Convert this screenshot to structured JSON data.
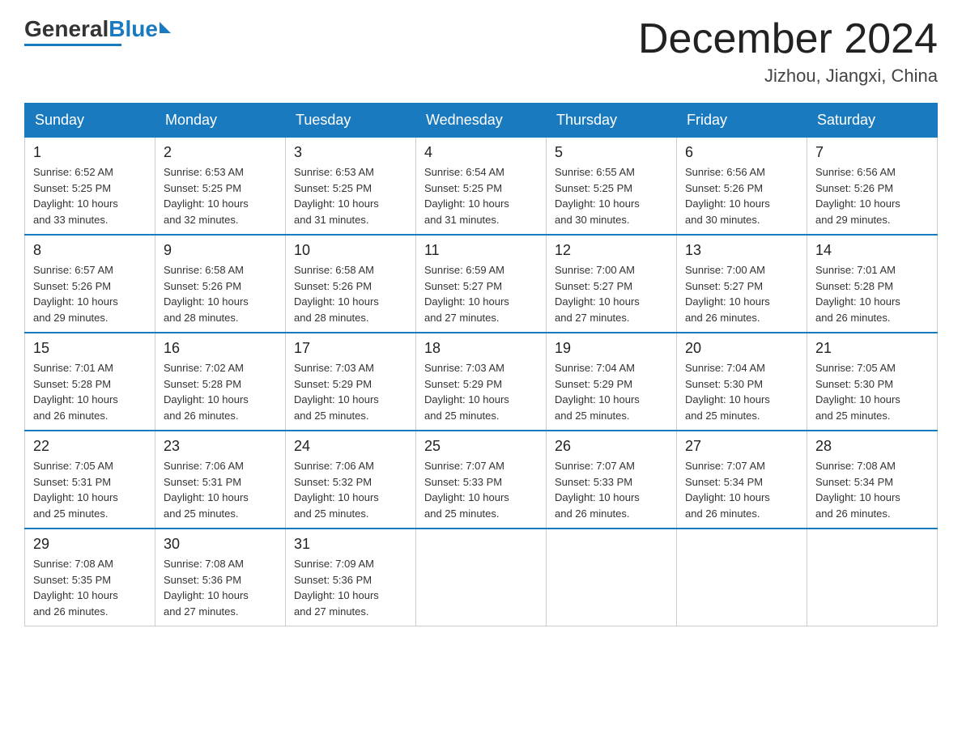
{
  "header": {
    "logo": {
      "general": "General",
      "blue": "Blue"
    },
    "title": "December 2024",
    "location": "Jizhou, Jiangxi, China"
  },
  "days_of_week": [
    "Sunday",
    "Monday",
    "Tuesday",
    "Wednesday",
    "Thursday",
    "Friday",
    "Saturday"
  ],
  "weeks": [
    [
      {
        "day": "1",
        "sunrise": "6:52 AM",
        "sunset": "5:25 PM",
        "daylight": "10 hours and 33 minutes."
      },
      {
        "day": "2",
        "sunrise": "6:53 AM",
        "sunset": "5:25 PM",
        "daylight": "10 hours and 32 minutes."
      },
      {
        "day": "3",
        "sunrise": "6:53 AM",
        "sunset": "5:25 PM",
        "daylight": "10 hours and 31 minutes."
      },
      {
        "day": "4",
        "sunrise": "6:54 AM",
        "sunset": "5:25 PM",
        "daylight": "10 hours and 31 minutes."
      },
      {
        "day": "5",
        "sunrise": "6:55 AM",
        "sunset": "5:25 PM",
        "daylight": "10 hours and 30 minutes."
      },
      {
        "day": "6",
        "sunrise": "6:56 AM",
        "sunset": "5:26 PM",
        "daylight": "10 hours and 30 minutes."
      },
      {
        "day": "7",
        "sunrise": "6:56 AM",
        "sunset": "5:26 PM",
        "daylight": "10 hours and 29 minutes."
      }
    ],
    [
      {
        "day": "8",
        "sunrise": "6:57 AM",
        "sunset": "5:26 PM",
        "daylight": "10 hours and 29 minutes."
      },
      {
        "day": "9",
        "sunrise": "6:58 AM",
        "sunset": "5:26 PM",
        "daylight": "10 hours and 28 minutes."
      },
      {
        "day": "10",
        "sunrise": "6:58 AM",
        "sunset": "5:26 PM",
        "daylight": "10 hours and 28 minutes."
      },
      {
        "day": "11",
        "sunrise": "6:59 AM",
        "sunset": "5:27 PM",
        "daylight": "10 hours and 27 minutes."
      },
      {
        "day": "12",
        "sunrise": "7:00 AM",
        "sunset": "5:27 PM",
        "daylight": "10 hours and 27 minutes."
      },
      {
        "day": "13",
        "sunrise": "7:00 AM",
        "sunset": "5:27 PM",
        "daylight": "10 hours and 26 minutes."
      },
      {
        "day": "14",
        "sunrise": "7:01 AM",
        "sunset": "5:28 PM",
        "daylight": "10 hours and 26 minutes."
      }
    ],
    [
      {
        "day": "15",
        "sunrise": "7:01 AM",
        "sunset": "5:28 PM",
        "daylight": "10 hours and 26 minutes."
      },
      {
        "day": "16",
        "sunrise": "7:02 AM",
        "sunset": "5:28 PM",
        "daylight": "10 hours and 26 minutes."
      },
      {
        "day": "17",
        "sunrise": "7:03 AM",
        "sunset": "5:29 PM",
        "daylight": "10 hours and 25 minutes."
      },
      {
        "day": "18",
        "sunrise": "7:03 AM",
        "sunset": "5:29 PM",
        "daylight": "10 hours and 25 minutes."
      },
      {
        "day": "19",
        "sunrise": "7:04 AM",
        "sunset": "5:29 PM",
        "daylight": "10 hours and 25 minutes."
      },
      {
        "day": "20",
        "sunrise": "7:04 AM",
        "sunset": "5:30 PM",
        "daylight": "10 hours and 25 minutes."
      },
      {
        "day": "21",
        "sunrise": "7:05 AM",
        "sunset": "5:30 PM",
        "daylight": "10 hours and 25 minutes."
      }
    ],
    [
      {
        "day": "22",
        "sunrise": "7:05 AM",
        "sunset": "5:31 PM",
        "daylight": "10 hours and 25 minutes."
      },
      {
        "day": "23",
        "sunrise": "7:06 AM",
        "sunset": "5:31 PM",
        "daylight": "10 hours and 25 minutes."
      },
      {
        "day": "24",
        "sunrise": "7:06 AM",
        "sunset": "5:32 PM",
        "daylight": "10 hours and 25 minutes."
      },
      {
        "day": "25",
        "sunrise": "7:07 AM",
        "sunset": "5:33 PM",
        "daylight": "10 hours and 25 minutes."
      },
      {
        "day": "26",
        "sunrise": "7:07 AM",
        "sunset": "5:33 PM",
        "daylight": "10 hours and 26 minutes."
      },
      {
        "day": "27",
        "sunrise": "7:07 AM",
        "sunset": "5:34 PM",
        "daylight": "10 hours and 26 minutes."
      },
      {
        "day": "28",
        "sunrise": "7:08 AM",
        "sunset": "5:34 PM",
        "daylight": "10 hours and 26 minutes."
      }
    ],
    [
      {
        "day": "29",
        "sunrise": "7:08 AM",
        "sunset": "5:35 PM",
        "daylight": "10 hours and 26 minutes."
      },
      {
        "day": "30",
        "sunrise": "7:08 AM",
        "sunset": "5:36 PM",
        "daylight": "10 hours and 27 minutes."
      },
      {
        "day": "31",
        "sunrise": "7:09 AM",
        "sunset": "5:36 PM",
        "daylight": "10 hours and 27 minutes."
      },
      null,
      null,
      null,
      null
    ]
  ],
  "labels": {
    "sunrise": "Sunrise:",
    "sunset": "Sunset:",
    "daylight": "Daylight:"
  }
}
